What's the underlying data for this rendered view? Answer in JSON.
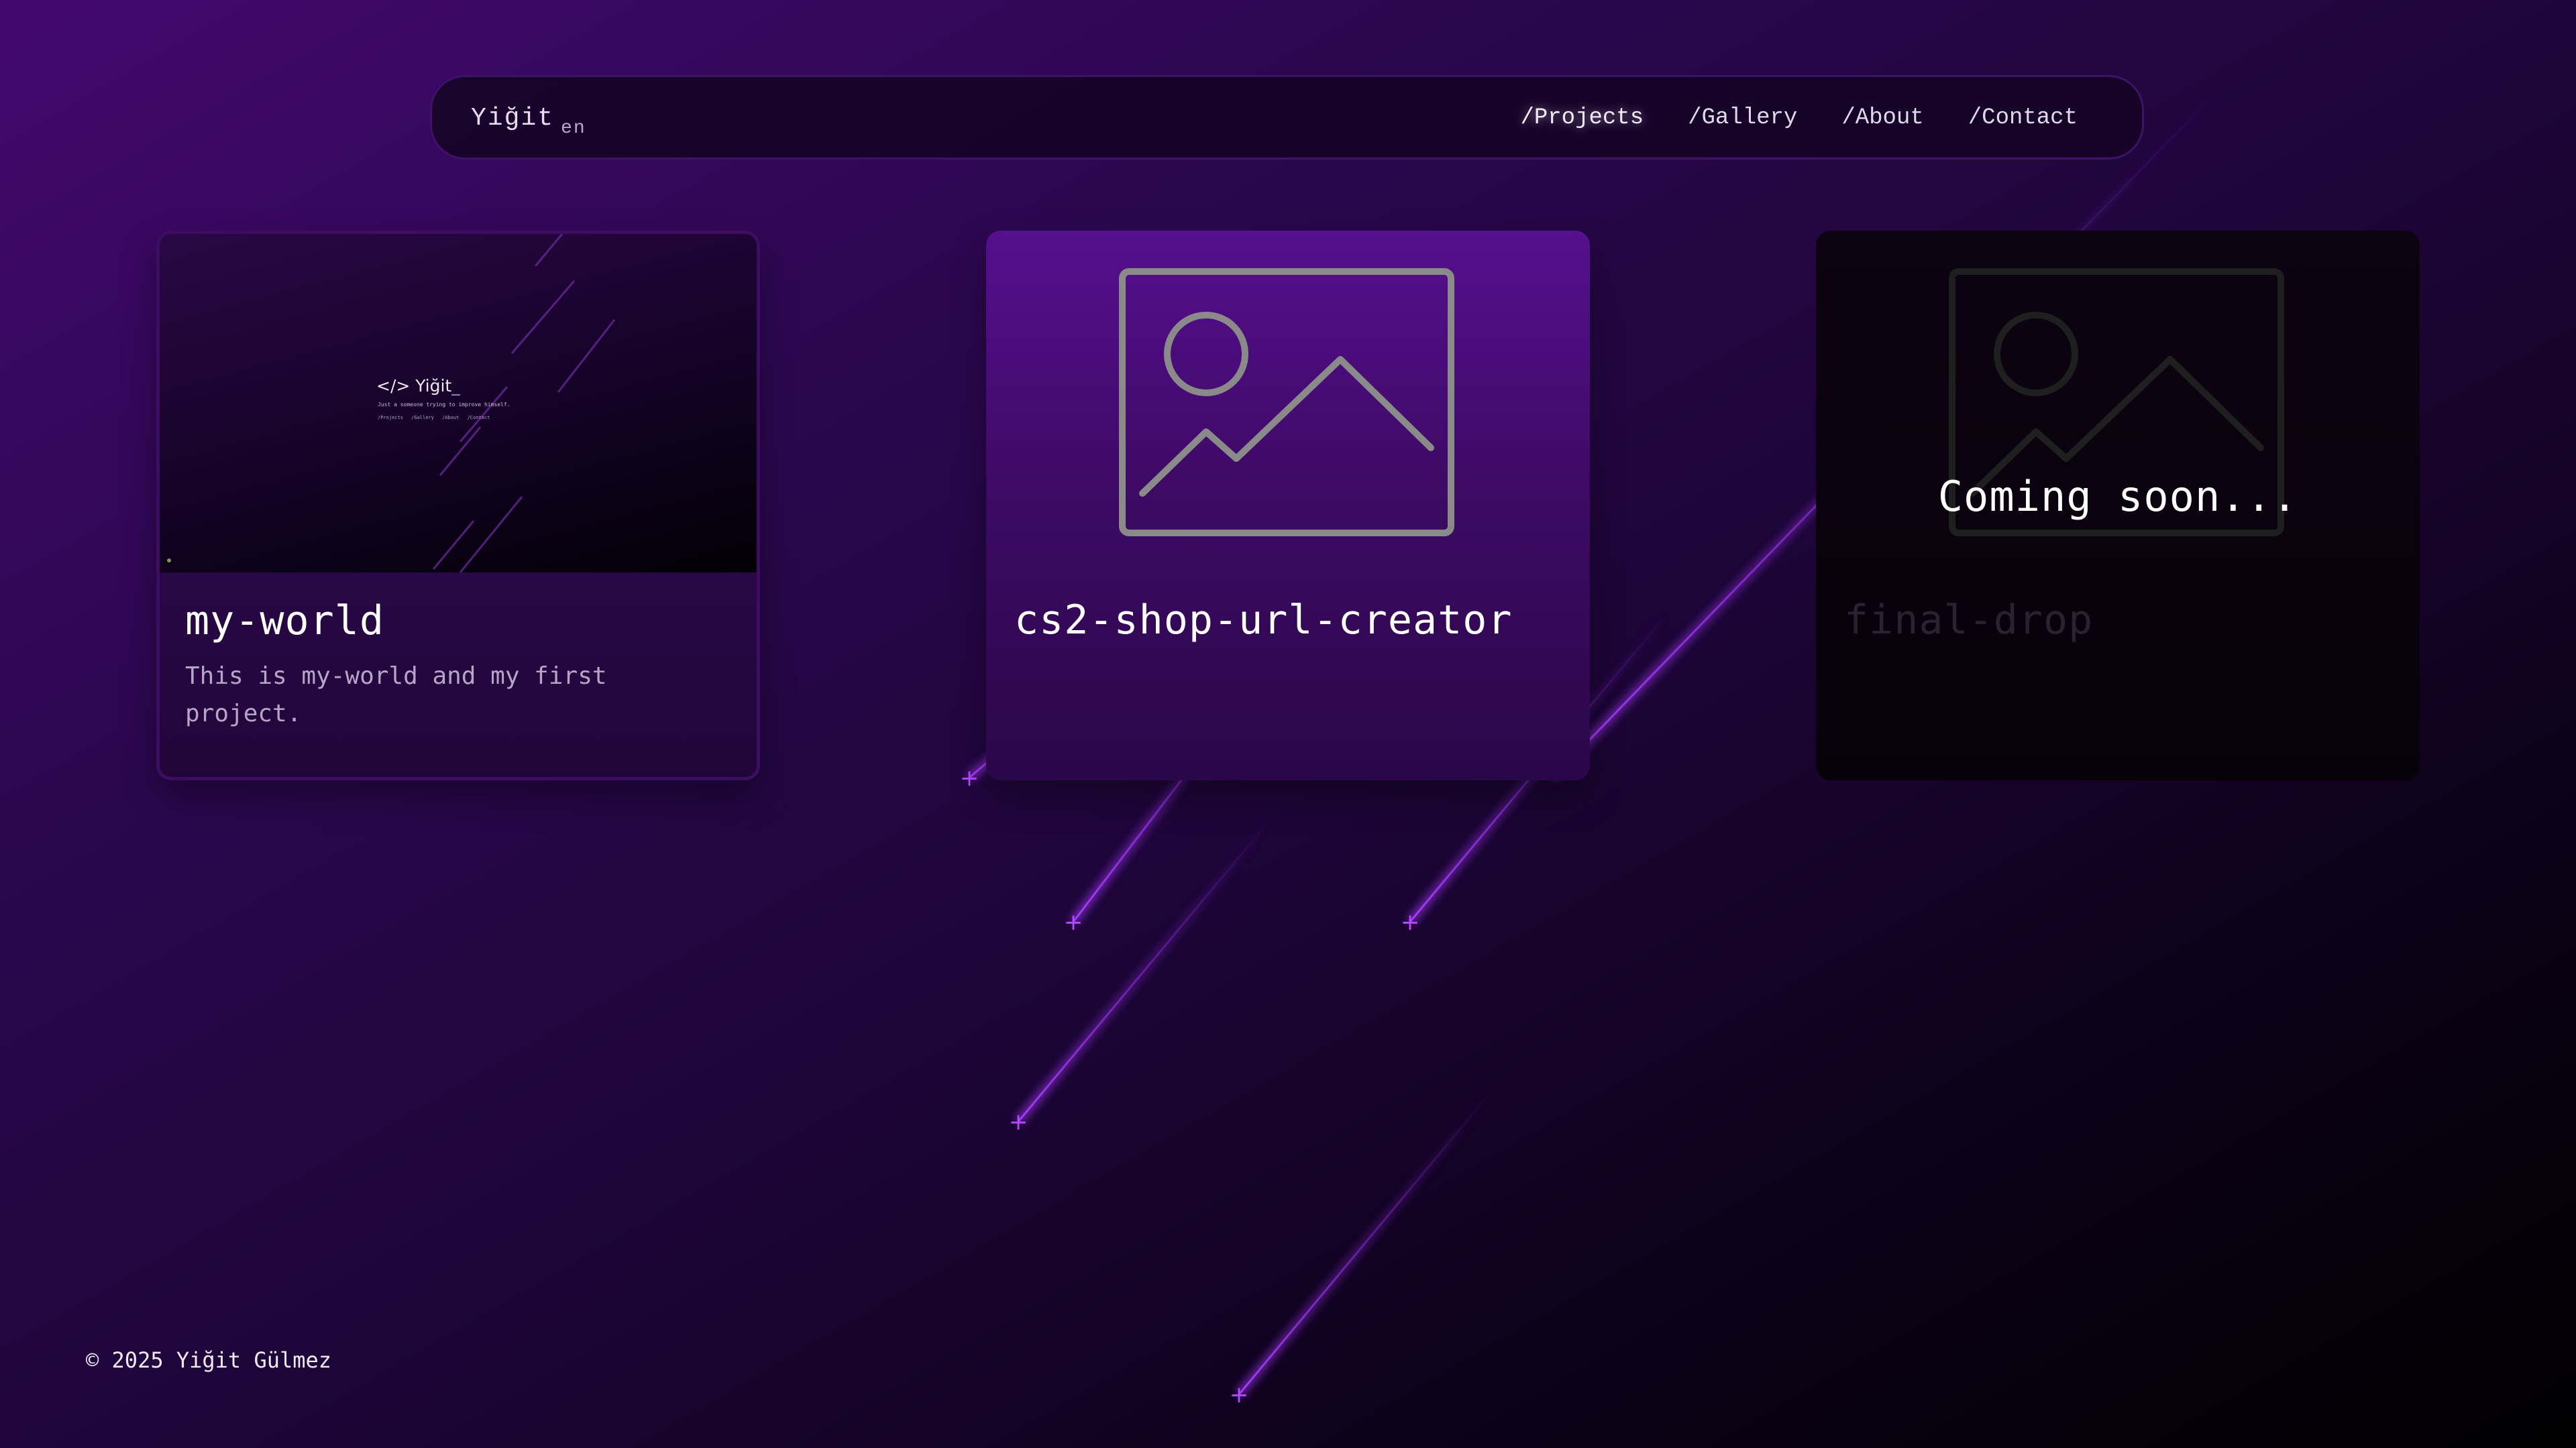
{
  "nav": {
    "brand": "Yiğit",
    "lang": "en",
    "links": [
      {
        "label": "/Projects",
        "active": true
      },
      {
        "label": "/Gallery",
        "active": false
      },
      {
        "label": "/About",
        "active": false
      },
      {
        "label": "/Contact",
        "active": false
      }
    ]
  },
  "projects": [
    {
      "title": "my-world",
      "description": "This is my-world and my first project.",
      "thumbnail": {
        "brand": "Yiğit",
        "cursor": "_",
        "icon": "code-brackets-icon",
        "tagline": "Just a someone trying to improve himself.",
        "nav": "/Projects /Gallery /About /Contact"
      }
    },
    {
      "title": "cs2-shop-url-creator",
      "icon": "image-placeholder-icon"
    },
    {
      "title": "final-drop",
      "status": "Coming soon...",
      "icon": "image-placeholder-icon"
    }
  ],
  "footer": {
    "copyright": "© 2025 Yiğit Gülmez"
  },
  "colors": {
    "background_top": "#43086e",
    "background_bottom": "#000000",
    "accent": "#8a2be2",
    "card_active": "#560f8e"
  }
}
